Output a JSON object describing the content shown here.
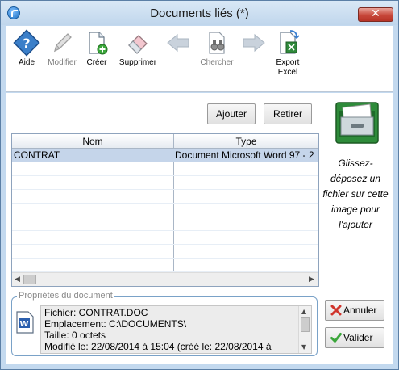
{
  "window": {
    "title": "Documents liés (*)",
    "close_glyph": "✕"
  },
  "toolbar": {
    "items": [
      {
        "label": "Aide",
        "icon": "help-icon",
        "enabled": true
      },
      {
        "label": "Modifier",
        "icon": "pencil-icon",
        "enabled": false
      },
      {
        "label": "Créer",
        "icon": "new-document-icon",
        "enabled": true
      },
      {
        "label": "Supprimer",
        "icon": "eraser-icon",
        "enabled": true
      },
      {
        "label": "",
        "icon": "arrow-left-icon",
        "enabled": false
      },
      {
        "label": "Chercher",
        "icon": "binoculars-icon",
        "enabled": false
      },
      {
        "label": "",
        "icon": "arrow-right-icon",
        "enabled": false
      },
      {
        "label": "Export\nExcel",
        "icon": "excel-export-icon",
        "enabled": true
      }
    ]
  },
  "actions": {
    "add_label": "Ajouter",
    "remove_label": "Retirer"
  },
  "grid": {
    "columns": [
      "Nom",
      "Type"
    ],
    "rows": [
      {
        "name": "CONTRAT",
        "type": "Document Microsoft Word 97 - 2",
        "selected": true
      }
    ]
  },
  "drop_zone": {
    "text": "Glissez-déposez un fichier sur cette image pour l'ajouter",
    "icon": "file-cabinet-icon"
  },
  "properties": {
    "legend": "Propriétés du document",
    "lines": [
      "Fichier: CONTRAT.DOC",
      "Emplacement: C:\\DOCUMENTS\\",
      "Taille: 0 octets",
      "Modifié le: 22/08/2014 à 15:04   (créé le: 22/08/2014 à"
    ]
  },
  "footer": {
    "cancel_label": "Annuler",
    "validate_label": "Valider"
  },
  "colors": {
    "accent": "#c3d9ef",
    "selected_row": "#c5d5ea",
    "cancel_icon": "#d0342c",
    "validate_icon": "#3aa63a"
  }
}
